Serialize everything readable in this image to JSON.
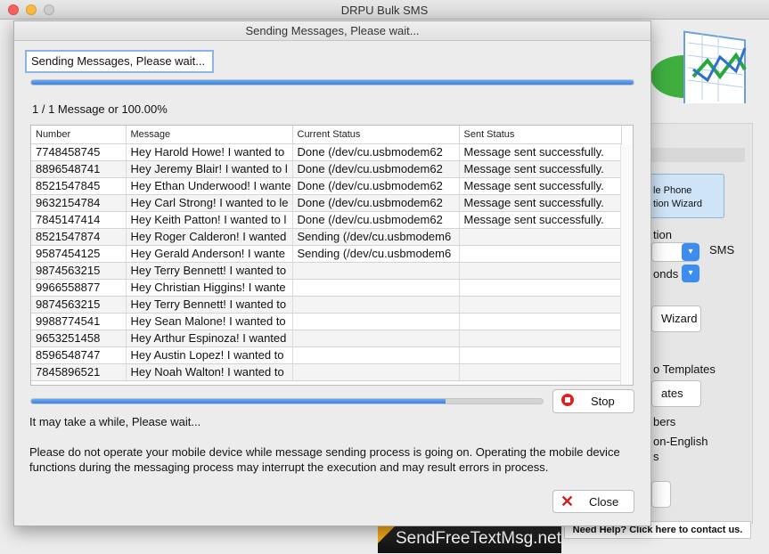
{
  "window": {
    "title": "DRPU Bulk SMS"
  },
  "background": {
    "wizard_line1": "le Phone",
    "wizard_line2": "tion  Wizard",
    "sms_label": "SMS",
    "option_label": "tion",
    "seconds_label": "onds",
    "wizard_button": "Wizard",
    "templates_label": "o Templates",
    "templates_button": "ates",
    "numbers_label": "bers",
    "non_english_label": "on-English",
    "non_english_cont": "s",
    "help_link": "Need Help? Click here to contact us.",
    "brand": "SendFreeTextMsg.net"
  },
  "dialog": {
    "title": "Sending Messages, Please wait...",
    "status_text": "Sending Messages, Please wait...",
    "overall_progress": 1.0,
    "count_text": "1 / 1 Message or 100.00%",
    "sub_progress": 0.81,
    "stop_label": "Stop",
    "close_label": "Close",
    "wait_text": "It may take a while, Please wait...",
    "warning_text": "Please do not operate your mobile device while message sending process is going on. Operating the mobile device functions during the messaging process may interrupt the execution and may result errors in process."
  },
  "table": {
    "columns": [
      "Number",
      "Message",
      "Current Status",
      "Sent Status"
    ],
    "rows": [
      [
        "7748458745",
        "Hey Harold Howe! I wanted to",
        "Done (/dev/cu.usbmodem62",
        "Message sent successfully."
      ],
      [
        "8896548741",
        "Hey Jeremy Blair! I wanted to l",
        "Done (/dev/cu.usbmodem62",
        "Message sent successfully."
      ],
      [
        "8521547845",
        "Hey Ethan Underwood! I wante",
        "Done (/dev/cu.usbmodem62",
        "Message sent successfully."
      ],
      [
        "9632154784",
        "Hey Carl Strong! I wanted to le",
        "Done (/dev/cu.usbmodem62",
        "Message sent successfully."
      ],
      [
        "7845147414",
        "Hey Keith Patton! I wanted to l",
        "Done (/dev/cu.usbmodem62",
        "Message sent successfully."
      ],
      [
        "8521547874",
        "Hey Roger Calderon! I wanted",
        "Sending (/dev/cu.usbmodem6",
        ""
      ],
      [
        "9587454125",
        "Hey Gerald Anderson! I wante",
        "Sending (/dev/cu.usbmodem6",
        ""
      ],
      [
        "9874563215",
        "Hey Terry Bennett! I wanted to",
        "",
        ""
      ],
      [
        "9966558877",
        "Hey Christian Higgins! I wante",
        "",
        ""
      ],
      [
        "9874563215",
        "Hey Terry Bennett! I wanted to",
        "",
        ""
      ],
      [
        "9988774541",
        "Hey Sean Malone! I wanted to",
        "",
        ""
      ],
      [
        "9653251458",
        "Hey Arthur Espinoza! I wanted",
        "",
        ""
      ],
      [
        "8596548747",
        "Hey Austin Lopez! I wanted to",
        "",
        ""
      ],
      [
        "7845896521",
        "Hey Noah Walton! I wanted to",
        "",
        ""
      ]
    ]
  },
  "colors": {
    "accent": "#3a83e6",
    "stop_red": "#dd2222",
    "close_red": "#d01e1e"
  }
}
